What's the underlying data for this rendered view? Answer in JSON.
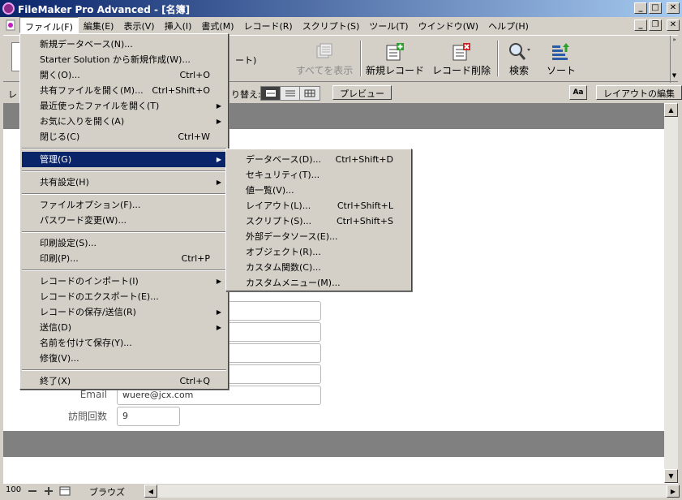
{
  "window": {
    "title": "FileMaker Pro Advanced - [名簿]"
  },
  "menubar": [
    "ファイル(F)",
    "編集(E)",
    "表示(V)",
    "挿入(I)",
    "書式(M)",
    "レコード(R)",
    "スクリプト(S)",
    "ツール(T)",
    "ウインドウ(W)",
    "ヘルプ(H)"
  ],
  "toolbar": {
    "partial_label": "ート)",
    "show_all": "すべてを表示",
    "new_record": "新規レコード",
    "delete_record": "レコード削除",
    "find": "検索",
    "sort": "ソート"
  },
  "status_toolbar": {
    "layout_label_partial": "レ",
    "switch_label_partial": "り替え:",
    "preview": "プレビュー",
    "aa": "Aa",
    "edit_layout": "レイアウトの編集"
  },
  "file_menu": [
    {
      "label": "新規データベース(N)...",
      "shortcut": ""
    },
    {
      "label": "Starter Solution から新規作成(W)...",
      "shortcut": ""
    },
    {
      "label": "開く(O)...",
      "shortcut": "Ctrl+O"
    },
    {
      "label": "共有ファイルを開く(M)...",
      "shortcut": "Ctrl+Shift+O"
    },
    {
      "label": "最近使ったファイルを開く(T)",
      "shortcut": "",
      "submenu": true
    },
    {
      "label": "お気に入りを開く(A)",
      "shortcut": "",
      "submenu": true
    },
    {
      "label": "閉じる(C)",
      "shortcut": "Ctrl+W"
    },
    {
      "label": "管理(G)",
      "shortcut": "",
      "submenu": true,
      "highlighted": true
    },
    {
      "label": "共有設定(H)",
      "shortcut": "",
      "submenu": true
    },
    {
      "label": "ファイルオプション(F)...",
      "shortcut": ""
    },
    {
      "label": "パスワード変更(W)...",
      "shortcut": ""
    },
    {
      "label": "印刷設定(S)...",
      "shortcut": ""
    },
    {
      "label": "印刷(P)...",
      "shortcut": "Ctrl+P"
    },
    {
      "label": "レコードのインポート(I)",
      "shortcut": "",
      "submenu": true
    },
    {
      "label": "レコードのエクスポート(E)...",
      "shortcut": ""
    },
    {
      "label": "レコードの保存/送信(R)",
      "shortcut": "",
      "submenu": true
    },
    {
      "label": "送信(D)",
      "shortcut": "",
      "submenu": true
    },
    {
      "label": "名前を付けて保存(Y)...",
      "shortcut": ""
    },
    {
      "label": "修復(V)...",
      "shortcut": ""
    },
    {
      "label": "終了(X)",
      "shortcut": "Ctrl+Q"
    }
  ],
  "manage_submenu": [
    {
      "label": "データベース(D)...",
      "shortcut": "Ctrl+Shift+D"
    },
    {
      "label": "セキュリティ(T)...",
      "shortcut": ""
    },
    {
      "label": "値一覧(V)...",
      "shortcut": ""
    },
    {
      "label": "レイアウト(L)...",
      "shortcut": "Ctrl+Shift+L"
    },
    {
      "label": "スクリプト(S)...",
      "shortcut": "Ctrl+Shift+S"
    },
    {
      "label": "外部データソース(E)...",
      "shortcut": ""
    },
    {
      "label": "オブジェクト(R)...",
      "shortcut": ""
    },
    {
      "label": "カスタム関数(C)...",
      "shortcut": ""
    },
    {
      "label": "カスタムメニュー(M)...",
      "shortcut": ""
    }
  ],
  "form": {
    "email_label": "Email",
    "email_value": "wuere@jcx.com",
    "visits_label": "訪問回数",
    "visits_value": "9"
  },
  "bottom": {
    "zoom": "100",
    "mode": "ブラウズ"
  }
}
